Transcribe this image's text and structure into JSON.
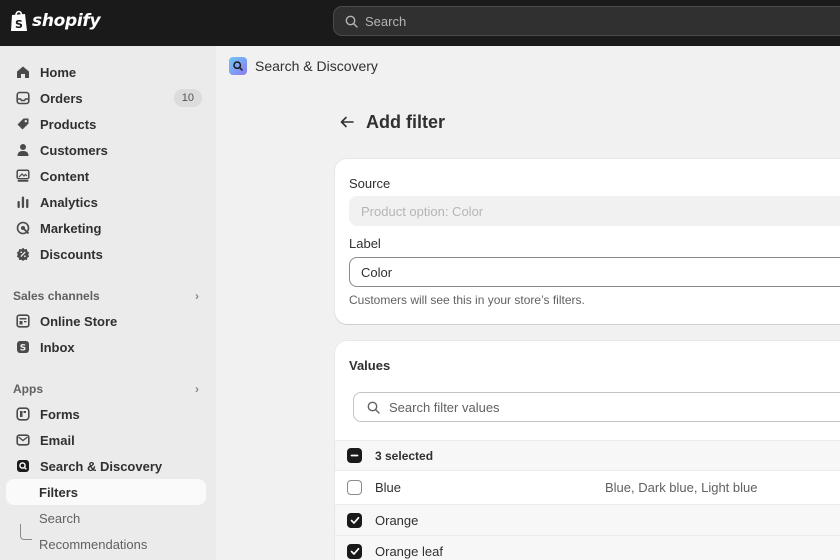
{
  "brand": {
    "logo_text": "shopify"
  },
  "topbar": {
    "search_placeholder": "Search"
  },
  "sidebar": {
    "items": [
      {
        "label": "Home",
        "icon": "home-icon"
      },
      {
        "label": "Orders",
        "icon": "inbox-tray-icon",
        "badge": "10"
      },
      {
        "label": "Products",
        "icon": "tag-icon"
      },
      {
        "label": "Customers",
        "icon": "person-icon"
      },
      {
        "label": "Content",
        "icon": "image-icon"
      },
      {
        "label": "Analytics",
        "icon": "bar-chart-icon"
      },
      {
        "label": "Marketing",
        "icon": "target-icon"
      },
      {
        "label": "Discounts",
        "icon": "discount-icon"
      }
    ],
    "sales_channels": {
      "heading": "Sales channels",
      "items": [
        {
          "label": "Online Store",
          "icon": "store-icon"
        },
        {
          "label": "Inbox",
          "icon": "chat-icon"
        }
      ]
    },
    "apps": {
      "heading": "Apps",
      "items": [
        {
          "label": "Forms",
          "icon": "forms-icon"
        },
        {
          "label": "Email",
          "icon": "envelope-icon"
        },
        {
          "label": "Search & Discovery",
          "icon": "search-app-icon"
        }
      ],
      "sub_items": [
        {
          "label": "Filters",
          "active": true
        },
        {
          "label": "Search",
          "active": false
        },
        {
          "label": "Recommendations",
          "active": false
        }
      ]
    }
  },
  "main": {
    "app_title": "Search & Discovery",
    "page_title": "Add filter",
    "source": {
      "label": "Source",
      "value": "Product option:  Color"
    },
    "label_field": {
      "label": "Label",
      "value": "Color",
      "help": "Customers will see this in your store’s filters."
    },
    "values": {
      "title": "Values",
      "search_placeholder": "Search filter values",
      "selected_text": "3 selected",
      "rows": [
        {
          "name": "Blue",
          "alias": "Blue, Dark blue, Light blue",
          "checked": false
        },
        {
          "name": "Orange",
          "alias": "",
          "checked": true
        },
        {
          "name": "Orange leaf",
          "alias": "",
          "checked": true
        }
      ]
    }
  },
  "colors": {
    "topbar": "#1a1a1a",
    "sidebar": "#ebebeb",
    "page": "#f1f1f1",
    "card": "#ffffff",
    "checkbox_checked": "#1a1a1a"
  }
}
